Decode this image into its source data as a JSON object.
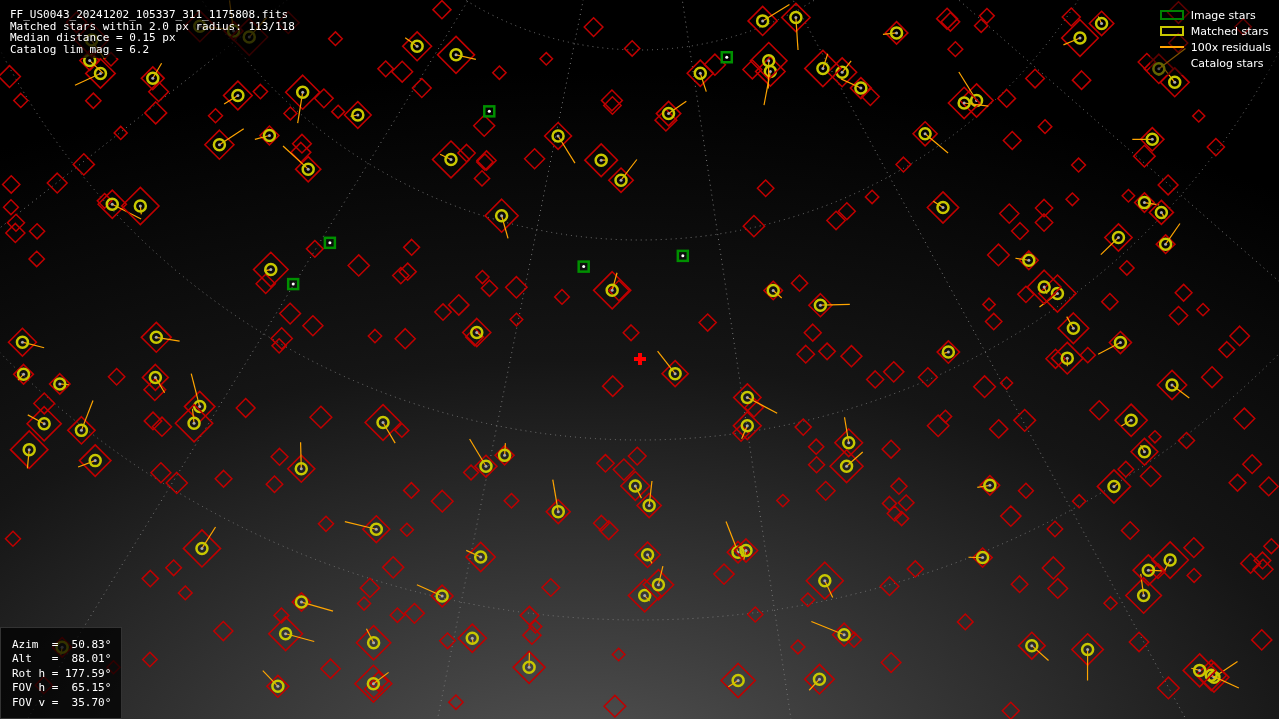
{
  "info": {
    "lines": [
      "FF_US0043_20241202_105337_311_1175808.fits",
      "Matched stars within 2.0 px radius: 113/118",
      "Median distance = 0.15 px",
      "Catalog lim mag = 6.2"
    ]
  },
  "legend": {
    "items": [
      {
        "label": "Image stars",
        "kind": "image"
      },
      {
        "label": "Matched stars",
        "kind": "matched"
      },
      {
        "label": "100x residuals",
        "kind": "residual"
      },
      {
        "label": "Catalog stars",
        "kind": "catalog"
      }
    ]
  },
  "pointing": {
    "lines": [
      "Azim  =  50.83°",
      "Alt   =  88.01°",
      "Rot h = 177.59°",
      "FOV h =  65.15°",
      "FOV v =  35.70°"
    ]
  }
}
